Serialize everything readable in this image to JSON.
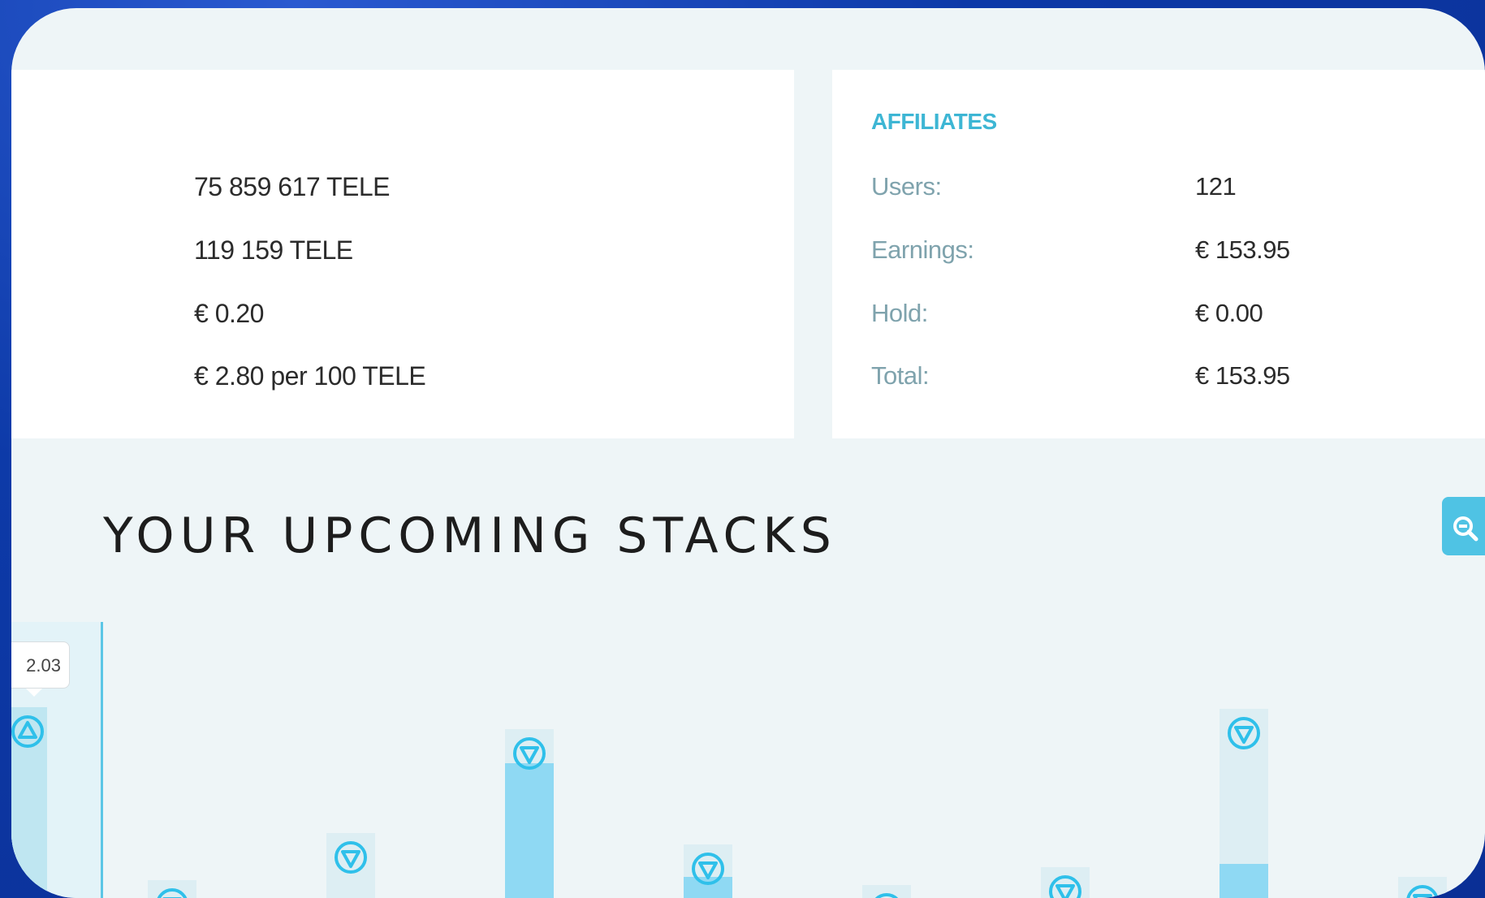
{
  "stats": {
    "lines": [
      "75 859 617 TELE",
      "119 159 TELE",
      "€ 0.20",
      "€ 2.80 per 100 TELE"
    ]
  },
  "affiliates": {
    "title": "AFFILIATES",
    "rows": [
      {
        "label": "Users:",
        "value": "121"
      },
      {
        "label": "Earnings:",
        "value": "€ 153.95"
      },
      {
        "label": "Hold:",
        "value": "€ 0.00"
      },
      {
        "label": "Total:",
        "value": "€ 153.95"
      }
    ]
  },
  "section": {
    "title": "YOUR UPCOMING STACKS"
  },
  "icons": {
    "zoom": "zoom-out-icon",
    "stack_up": "triangle-up-circle-icon",
    "stack_down": "triangle-down-circle-icon"
  },
  "colors": {
    "accent": "#3db6d4",
    "bar": "#8fd9f3",
    "background": "#0d3aa8"
  },
  "chart_data": {
    "type": "bar",
    "tooltip": "2.03",
    "bars": [
      {
        "direction": "up",
        "filled_fraction": 1.0,
        "highlighted": true
      },
      {
        "direction": "down",
        "filled_fraction": 0.0
      },
      {
        "direction": "down",
        "filled_fraction": 0.0
      },
      {
        "direction": "down",
        "filled_fraction": 0.8
      },
      {
        "direction": "down",
        "filled_fraction": 0.4
      },
      {
        "direction": "down",
        "filled_fraction": 0.0
      },
      {
        "direction": "down",
        "filled_fraction": 0.0
      },
      {
        "direction": "down",
        "filled_fraction": 0.18
      },
      {
        "direction": "down",
        "filled_fraction": 0.0
      }
    ]
  }
}
